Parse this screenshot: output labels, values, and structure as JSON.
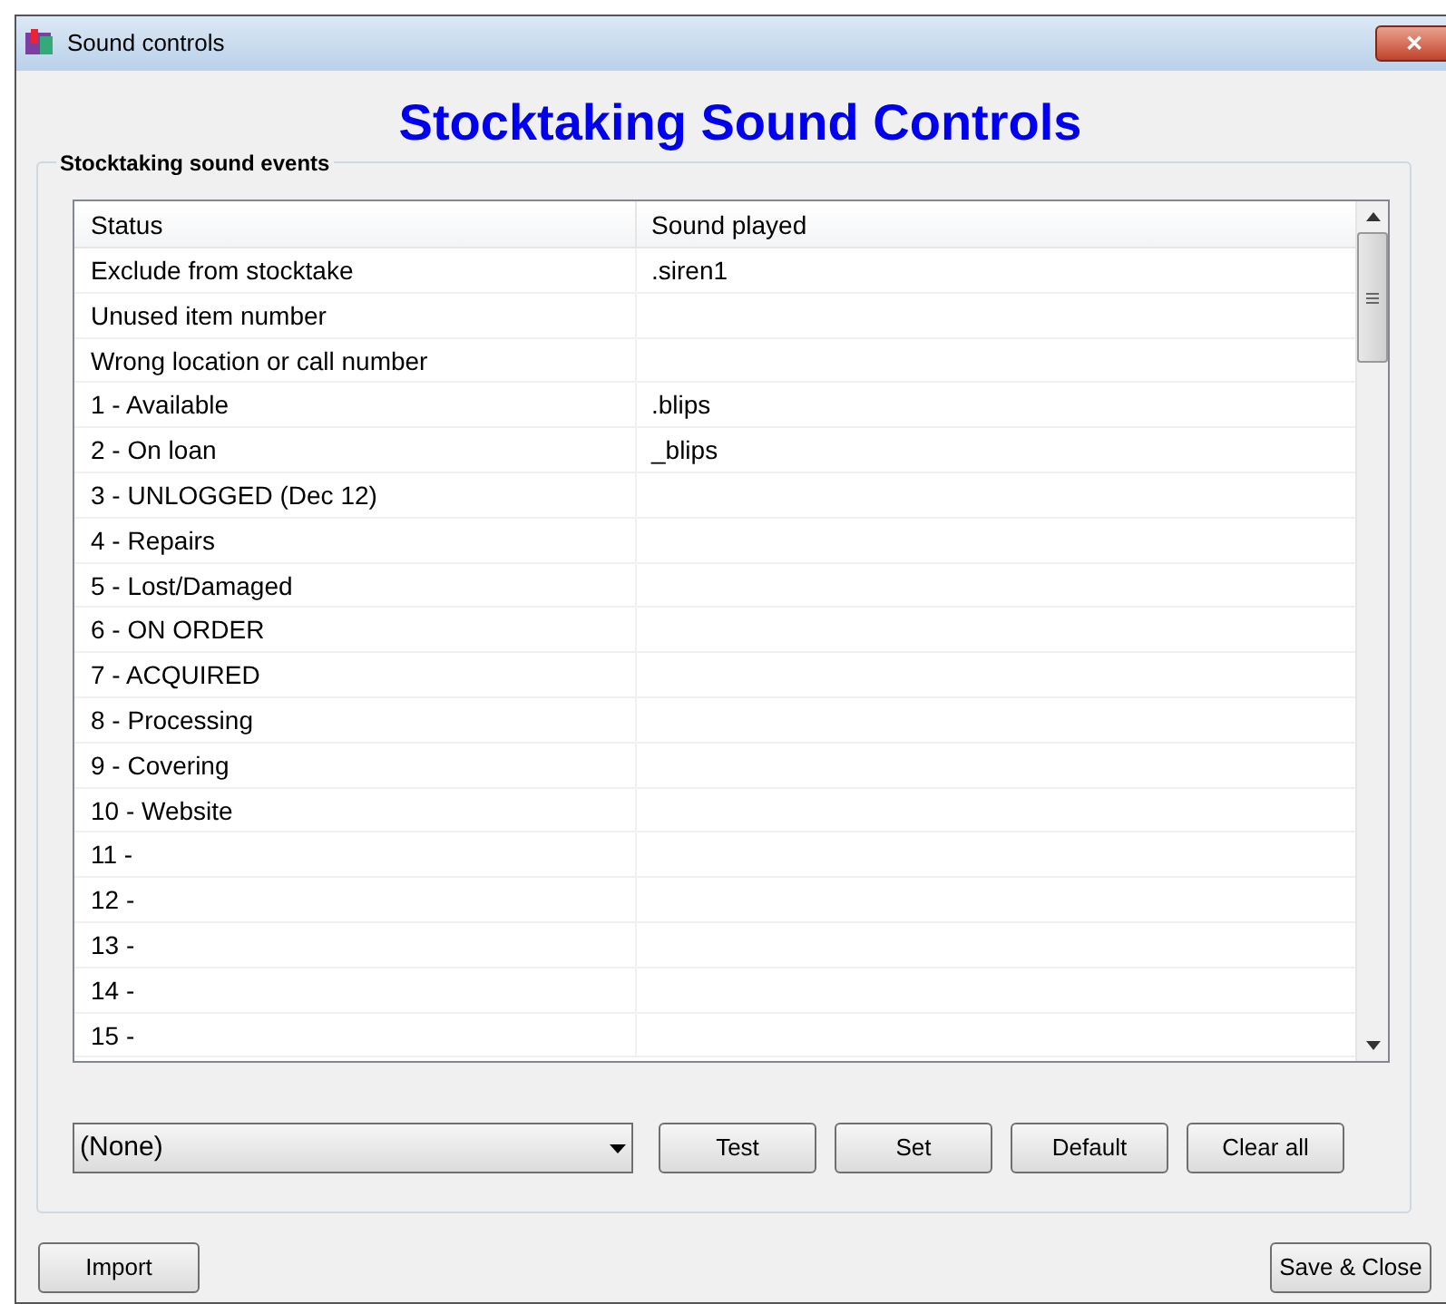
{
  "window": {
    "title": "Sound controls",
    "close": "✕"
  },
  "heading": "Stocktaking Sound Controls",
  "group": {
    "title": "Stocktaking sound events",
    "table": {
      "columns": [
        "Status",
        "Sound played"
      ],
      "rows": [
        {
          "status": "Exclude from stocktake",
          "sound": ".siren1"
        },
        {
          "status": "Unused item number"
        },
        {
          "status": "Wrong location or call number"
        },
        {
          "status": "1 - Available",
          "sound": ".blips"
        },
        {
          "status": "2 - On loan",
          "sound": "_blips"
        },
        {
          "status": "3 - UNLOGGED (Dec 12)"
        },
        {
          "status": "4 - Repairs"
        },
        {
          "status": "5 - Lost/Damaged"
        },
        {
          "status": "6 - ON ORDER"
        },
        {
          "status": "7 - ACQUIRED"
        },
        {
          "status": "8 - Processing"
        },
        {
          "status": "9 - Covering"
        },
        {
          "status": "10 - Website"
        },
        {
          "status": "11 -"
        },
        {
          "status": "12 -"
        },
        {
          "status": "13 -"
        },
        {
          "status": "14 -"
        },
        {
          "status": "15 -"
        }
      ]
    },
    "sound_select": {
      "value": "(None)"
    },
    "buttons": [
      "Test",
      "Set",
      "Default",
      "Clear all"
    ]
  },
  "footer_buttons": [
    "Import",
    "Save & Close"
  ]
}
